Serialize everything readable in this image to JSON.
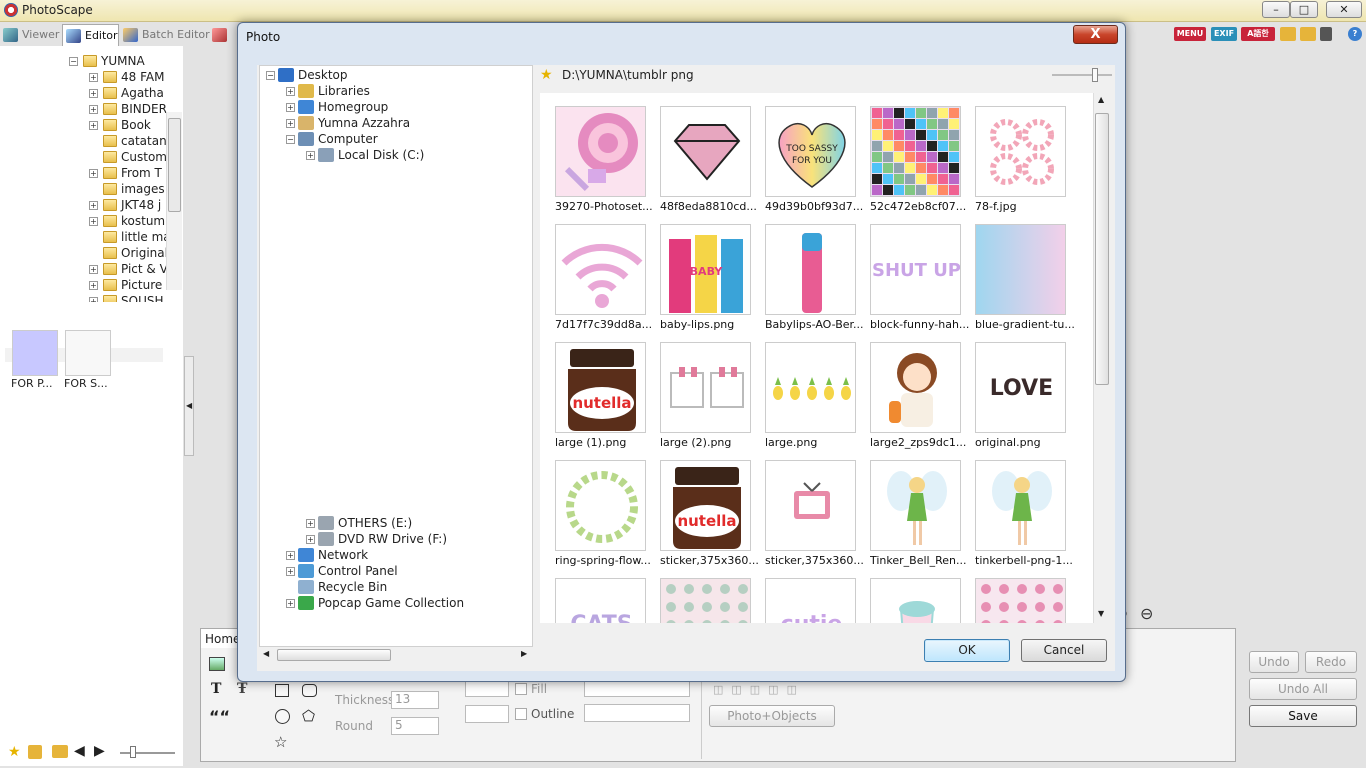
{
  "app": {
    "title": "PhotoScape",
    "window_buttons": [
      "–",
      "□",
      "✕"
    ],
    "tabs": [
      {
        "label": "Viewer",
        "icon": "viewer-icon"
      },
      {
        "label": "Editor",
        "icon": "editor-icon"
      },
      {
        "label": "Batch Editor",
        "icon": "batch-editor-icon"
      }
    ],
    "right_icons": [
      "MENU",
      "EXIF",
      "A語한"
    ]
  },
  "left_tree": {
    "root": "YUMNA",
    "items": [
      {
        "label": "48 FAM",
        "expandable": true
      },
      {
        "label": "Agatha",
        "expandable": true
      },
      {
        "label": "BINDER",
        "expandable": true
      },
      {
        "label": "Book",
        "expandable": true
      },
      {
        "label": "catatan",
        "expandable": false
      },
      {
        "label": "Custom",
        "expandable": false
      },
      {
        "label": "From T",
        "expandable": true
      },
      {
        "label": "images",
        "expandable": false
      },
      {
        "label": "JKT48 j",
        "expandable": true
      },
      {
        "label": "kostum",
        "expandable": true
      },
      {
        "label": "little ma",
        "expandable": false
      },
      {
        "label": "Originals",
        "expandable": false
      },
      {
        "label": "Pict & V",
        "expandable": true
      },
      {
        "label": "Picture",
        "expandable": true
      },
      {
        "label": "SOUSH",
        "expandable": true
      }
    ],
    "thumbs": [
      {
        "label": "FOR P...",
        "color": "#c8c8ff"
      },
      {
        "label": "FOR S...",
        "color": "#f8f8f8"
      }
    ]
  },
  "toolbar": {
    "home_tab": "Home",
    "thickness_label": "Thickness",
    "thickness_value": "13",
    "round_label": "Round",
    "round_value": "5",
    "fill_label": "Fill",
    "outline_label": "Outline",
    "photo_objects_label": "Photo+Objects",
    "undo_label": "Undo",
    "redo_label": "Redo",
    "undo_all_label": "Undo All",
    "save_label": "Save",
    "quote_glyph": "““"
  },
  "dialog": {
    "title": "Photo",
    "close_label": "X",
    "path": "D:\\YUMNA\\tumblr png",
    "ok_label": "OK",
    "cancel_label": "Cancel",
    "tree_top": [
      {
        "label": "Desktop",
        "level": 0,
        "pm": "−",
        "icon_color": "#2f6fc6"
      },
      {
        "label": "Libraries",
        "level": 1,
        "pm": "+",
        "icon_color": "#e0b94a"
      },
      {
        "label": "Homegroup",
        "level": 1,
        "pm": "+",
        "icon_color": "#3f86d6"
      },
      {
        "label": "Yumna Azzahra",
        "level": 1,
        "pm": "+",
        "icon_color": "#d9b46a"
      },
      {
        "label": "Computer",
        "level": 1,
        "pm": "−",
        "icon_color": "#6d8fb5"
      },
      {
        "label": "Local Disk (C:)",
        "level": 2,
        "pm": "+",
        "icon_color": "#8aa0b8"
      }
    ],
    "tree_bottom": [
      {
        "label": "OTHERS (E:)",
        "level": 2,
        "pm": "+",
        "icon_color": "#9aa5b0"
      },
      {
        "label": "DVD RW Drive (F:)",
        "level": 2,
        "pm": "+",
        "icon_color": "#9aa5b0"
      },
      {
        "label": "Network",
        "level": 1,
        "pm": "+",
        "icon_color": "#3f86d6"
      },
      {
        "label": "Control Panel",
        "level": 1,
        "pm": "+",
        "icon_color": "#4d9ad6"
      },
      {
        "label": "Recycle Bin",
        "level": 1,
        "pm": "",
        "icon_color": "#8fb0d0"
      },
      {
        "label": "Popcap Game Collection",
        "level": 1,
        "pm": "+",
        "icon_color": "#3aa84a"
      }
    ],
    "files": [
      {
        "name": "39270-Photoset...",
        "bg": "#fbe3ef",
        "fg": "#e58bc0",
        "art": "lollipop"
      },
      {
        "name": "48f8eda8810cd...",
        "bg": "#ffffff",
        "fg": "#e7a6bf",
        "art": "diamond"
      },
      {
        "name": "49d39b0bf93d7...",
        "bg": "#ffffff",
        "fg": "#f4a261",
        "art": "heart",
        "text": "TOO SASSY FOR YOU"
      },
      {
        "name": "52c472eb8cf07...",
        "bg": "#e8dff0",
        "fg": "#7a4f9a",
        "art": "collage"
      },
      {
        "name": "78-f.jpg",
        "bg": "#ffffff",
        "fg": "#f2a6b8",
        "art": "wreath"
      },
      {
        "name": "7d17f7c39dd8a...",
        "bg": "#ffffff",
        "fg": "#e9a7d6",
        "art": "wifi"
      },
      {
        "name": "baby-lips.png",
        "bg": "#ffffff",
        "fg": "#e23b7c",
        "art": "lipsticks"
      },
      {
        "name": "Babylips-AO-Ber...",
        "bg": "#ffffff",
        "fg": "#e85c93",
        "art": "lipstick"
      },
      {
        "name": "block-funny-hah...",
        "bg": "#ffffff",
        "fg": "#c9a4e6",
        "art": "text",
        "text": "SHUT UP"
      },
      {
        "name": "blue-gradient-tu...",
        "bg": "#cde6f6",
        "fg": "#f2d0ec",
        "art": "gradient"
      },
      {
        "name": "large (1).png",
        "bg": "#ffffff",
        "fg": "#5a2e1a",
        "art": "nutella",
        "text": "nutella"
      },
      {
        "name": "large (2).png",
        "bg": "#ffffff",
        "fg": "#e07a9a",
        "art": "frames"
      },
      {
        "name": "large.png",
        "bg": "#ffffff",
        "fg": "#f5d547",
        "art": "pineapples"
      },
      {
        "name": "large2_zps9dc1...",
        "bg": "#ffffff",
        "fg": "#c0622e",
        "art": "girl"
      },
      {
        "name": "original.png",
        "bg": "#ffffff",
        "fg": "#3a2a2a",
        "art": "text",
        "text": "LOVE"
      },
      {
        "name": "ring-spring-flow...",
        "bg": "#ffffff",
        "fg": "#b8d88a",
        "art": "ring"
      },
      {
        "name": "sticker,375x360...",
        "bg": "#ffffff",
        "fg": "#5a2e1a",
        "art": "nutella",
        "text": "nutella"
      },
      {
        "name": "sticker,375x360...",
        "bg": "#ffffff",
        "fg": "#e88aa8",
        "art": "tv"
      },
      {
        "name": "Tinker_Bell_Ren...",
        "bg": "#ffffff",
        "fg": "#6db54a",
        "art": "fairy"
      },
      {
        "name": "tinkerbell-png-1...",
        "bg": "#ffffff",
        "fg": "#6db54a",
        "art": "fairy"
      },
      {
        "name": "",
        "bg": "#ffffff",
        "fg": "#b9a6e0",
        "art": "text",
        "text": "CATS"
      },
      {
        "name": "",
        "bg": "#f6e6ea",
        "fg": "#9bc4b0",
        "art": "pattern"
      },
      {
        "name": "",
        "bg": "#ffffff",
        "fg": "#c9a4e6",
        "art": "text",
        "text": "cutie"
      },
      {
        "name": "",
        "bg": "#ffffff",
        "fg": "#9ed9d8",
        "art": "cup"
      },
      {
        "name": "",
        "bg": "#f7e7ef",
        "fg": "#e06a9a",
        "art": "pattern"
      }
    ]
  }
}
